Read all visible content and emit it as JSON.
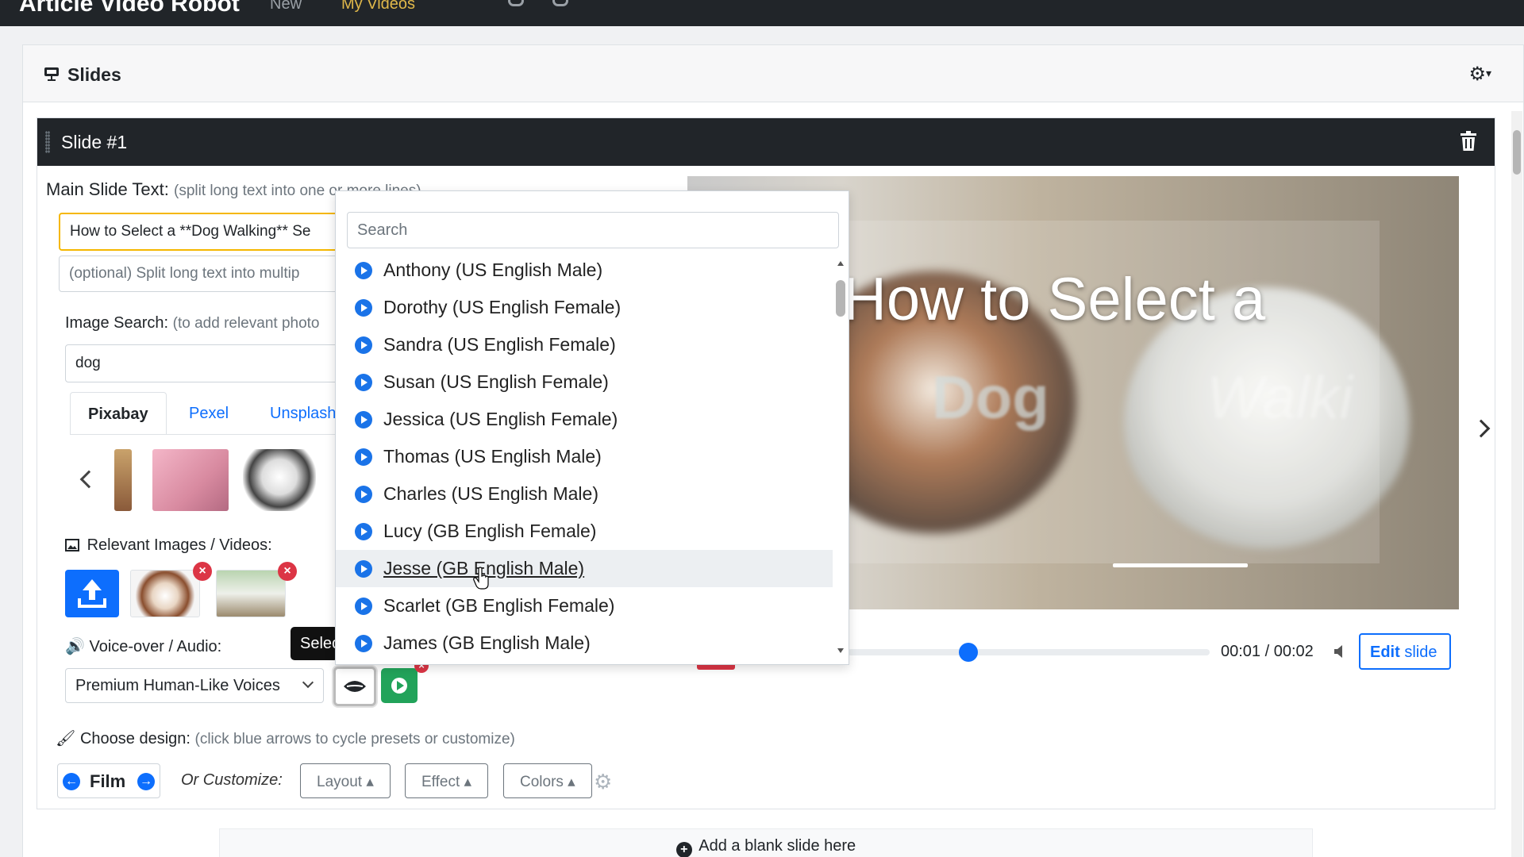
{
  "topbar": {
    "brand": "Article Video Robot",
    "nav_new": "New",
    "nav_my_videos": "My Videos"
  },
  "card": {
    "title": "Slides",
    "settings_icon": "gear-icon"
  },
  "slide": {
    "title": "Slide #1",
    "main_text_label": "Main Slide Text:",
    "main_text_hint": "(split long text into one or more lines)",
    "main_text_value": "How to Select a **Dog Walking** Se",
    "optional_placeholder": "(optional) Split long text into multip",
    "image_search_label": "Image Search:",
    "image_search_hint": "(to add relevant photo",
    "image_search_value": "dog",
    "tabs": [
      "Pixabay",
      "Pexel",
      "Unsplash"
    ],
    "relevant_label": "Relevant Images / Videos:",
    "voice_label": "Voice-over / Audio:",
    "tooltip_text": "Selec",
    "voice_select": "Premium Human-Like Voices",
    "design_label": "Choose design:",
    "design_hint": "(click blue arrows to cycle presets or customize)",
    "design_preset": "Film",
    "customize_label": "Or Customize:",
    "customize_buttons": [
      "Layout",
      "Effect",
      "Colors"
    ]
  },
  "preview": {
    "line1": "How to Select a",
    "line2": "Dog",
    "line3": "Walki",
    "time": "00:01 / 00:02",
    "edit_label": "Edit",
    "edit_label_2": "slide"
  },
  "voice_dropdown": {
    "search_placeholder": "Search",
    "options": [
      "Anthony (US English Male)",
      "Dorothy (US English Female)",
      "Sandra (US English Female)",
      "Susan (US English Female)",
      "Jessica (US English Female)",
      "Thomas (US English Male)",
      "Charles (US English Male)",
      "Lucy (GB English Female)",
      "Jesse (GB English Male)",
      "Scarlet (GB English Female)",
      "James (GB English Male)"
    ],
    "hovered": "Jesse (GB English Male)"
  },
  "add_blank": "Add a blank slide here",
  "colors": {
    "accent": "#0d6efd",
    "dark": "#212529",
    "play_green": "#22a35a",
    "remove_red": "#dc3545",
    "focus_yellow": "#f5b700"
  }
}
